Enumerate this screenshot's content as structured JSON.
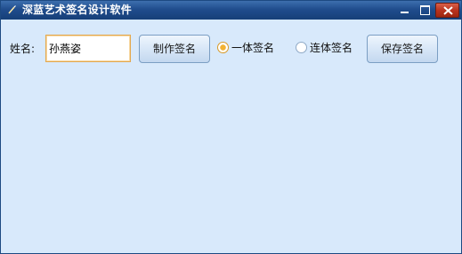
{
  "window": {
    "title": "深蓝艺术签名设计软件",
    "icons": {
      "app": "pen-icon",
      "minimize": "minimize-icon",
      "maximize": "maximize-icon",
      "close": "close-icon"
    }
  },
  "form": {
    "name_label": "姓名:",
    "name_value": "孙燕姿",
    "make_button": "制作签名",
    "radio_one": {
      "label": "一体签名",
      "checked": true
    },
    "radio_link": {
      "label": "连体签名",
      "checked": false
    },
    "save_button": "保存签名"
  },
  "colors": {
    "titlebar": "#204d8d",
    "client_background": "#d8e9fb",
    "close_button": "#b9341f",
    "radio_selected": "#f2b233"
  }
}
